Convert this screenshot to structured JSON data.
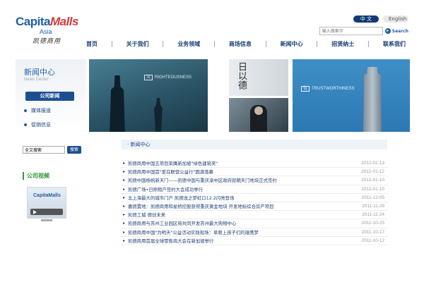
{
  "header": {
    "logo": {
      "main_a": "Capita",
      "main_b": "Malls",
      "region": "Asia",
      "cn": "凯德商用"
    },
    "lang": {
      "cn_label": "中 文",
      "en_label": "English"
    },
    "search": {
      "placeholder": "输入搜索字",
      "button_label": "Search"
    }
  },
  "nav": [
    "首页",
    "关于我们",
    "业务领域",
    "商场信息",
    "新闻中心",
    "招贤纳士",
    "联系我们"
  ],
  "sidebar": {
    "title": "新闻中心",
    "subtitle": "News Center",
    "items": [
      "公司新闻",
      "媒体报道",
      "促销信息"
    ],
    "site_search": {
      "value": "全文搜索",
      "button_label": "搜索"
    },
    "video": {
      "title": "公司视频",
      "thumb_logo": "CapitaMalls"
    }
  },
  "banner": {
    "caption_1": {
      "cn": "义",
      "en": "RIGHTEOUSNESS"
    },
    "caption_2": {
      "cn": "信",
      "en": "TRUSTWORTHINESS"
    },
    "calligraphy": "日以德"
  },
  "news": {
    "header": "新闻中心",
    "items": [
      {
        "title": "凯德商用中国五项目荣膺新加坡\"绿色建筑奖\"",
        "date": "2012-02-13"
      },
      {
        "title": "凯德商用中国首\"爱在联营公益行\"圆满落幕",
        "date": "2012-01-12"
      },
      {
        "title": "凯德中国杨帆新天门——凯德中国与重庆渝中区政府就朝天门地块正式签约",
        "date": "2012-01-10"
      },
      {
        "title": "凯德广场•日照租户签约大会成功举行",
        "date": "2012-01-10"
      },
      {
        "title": "北上海最大的城市门户 凯德龙之梦虹口12.2闪亮登场",
        "date": "2011-12-05"
      },
      {
        "title": "嘉德置地：凯德商用和星桥控股获得重庆黄金地块 开发地标综合房产项目",
        "date": "2011-11-29"
      },
      {
        "title": "凯德工城 德创未来",
        "date": "2011-11-24"
      },
      {
        "title": "凯德商用与苏州工业园区将共同开发苏州最大购物中心",
        "date": "2011-10-25"
      },
      {
        "title": "凯德商用中国\"为明天\"公益活动实践现场：草原上孩子们的雄鹰梦",
        "date": "2011-10-17"
      },
      {
        "title": "凯德商用首届全球零售商大会在新加坡举行",
        "date": "2011-10-12"
      }
    ]
  },
  "colors": {
    "primary": "#1f5fa8",
    "nav_dark": "#1a3f78",
    "active_bg": "#1d4f8f",
    "video_green": "#2e9a3a"
  }
}
